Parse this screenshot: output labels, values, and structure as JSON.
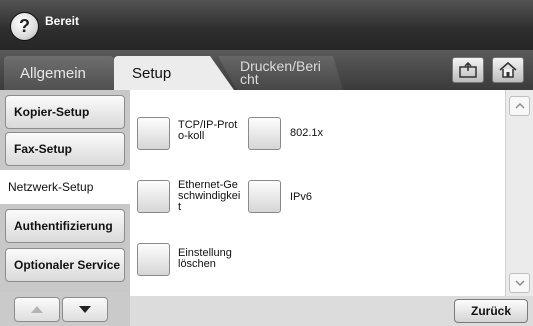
{
  "status": {
    "help_icon": "?",
    "text": "Bereit"
  },
  "tabs": [
    {
      "label": "Allgemein"
    },
    {
      "label": "Setup"
    },
    {
      "label_line1": "Drucken/Beri",
      "label_line2": "cht"
    }
  ],
  "toolbar": {
    "icons": [
      "export-icon",
      "home-icon"
    ]
  },
  "nav": {
    "items": [
      {
        "label": "Kopier-Setup"
      },
      {
        "label": "Fax-Setup"
      },
      {
        "label": "Netzwerk-Setup"
      },
      {
        "label": "Authentifizierung"
      },
      {
        "label": "Optionaler Service"
      }
    ],
    "active": "Netzwerk-Setup"
  },
  "options": [
    {
      "line1": "TCP/IP-Prot",
      "line2": "o-koll",
      "line3": ""
    },
    {
      "line1": "802.1x",
      "line2": "",
      "line3": ""
    },
    {
      "line1": "Ethernet-Ge",
      "line2": "schwindigkei",
      "line3": "t"
    },
    {
      "line1": "IPv6",
      "line2": "",
      "line3": ""
    },
    {
      "line1": "Einstellung",
      "line2": "löschen",
      "line3": ""
    }
  ],
  "footer": {
    "back_label": "Zurück"
  }
}
